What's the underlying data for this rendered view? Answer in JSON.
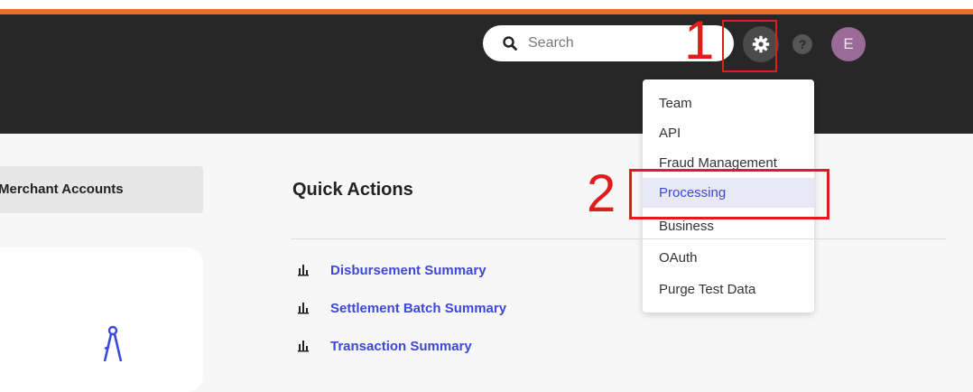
{
  "search": {
    "placeholder": "Search"
  },
  "user": {
    "avatar_initial": "E"
  },
  "help": {
    "glyph": "?"
  },
  "annotations": {
    "step1": "1",
    "step2": "2",
    "color": "#e01d1d"
  },
  "settings_menu": {
    "items": [
      {
        "label": "Team"
      },
      {
        "label": "API"
      },
      {
        "label": "Fraud Management"
      },
      {
        "label": "Processing",
        "active": true
      },
      {
        "label": "Business"
      },
      {
        "label": "OAuth"
      },
      {
        "label": "Purge Test Data"
      }
    ]
  },
  "sidebar": {
    "tab_label": "Merchant Accounts"
  },
  "quick_actions": {
    "title": "Quick Actions",
    "links": [
      {
        "label": "Disbursement Summary",
        "icon": "bar-chart-icon"
      },
      {
        "label": "Settlement Batch Summary",
        "icon": "bar-chart-icon"
      },
      {
        "label": "Transaction Summary",
        "icon": "bar-chart-icon"
      }
    ]
  },
  "colors": {
    "accent": "#f26b21",
    "header_bg": "#272727",
    "link": "#3d48d6",
    "avatar_bg": "#9a6b97"
  }
}
